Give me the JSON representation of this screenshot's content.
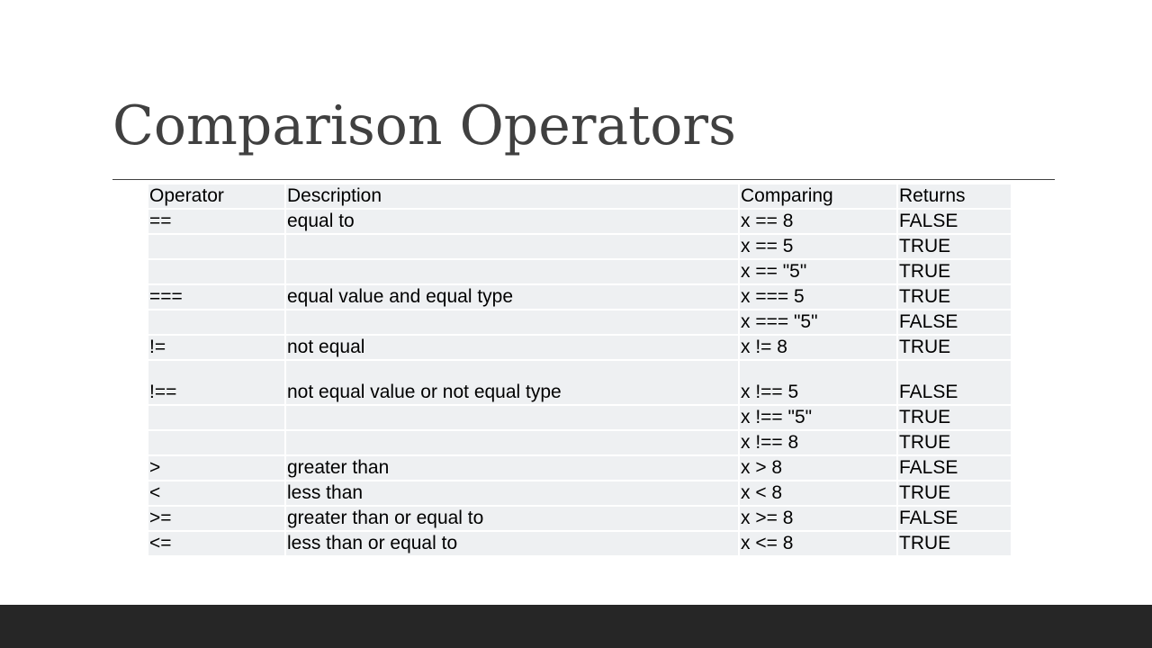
{
  "slide": {
    "title": "Comparison Operators"
  },
  "table": {
    "headers": [
      "Operator",
      "Description",
      "Comparing",
      "Returns"
    ],
    "rows": [
      [
        "==",
        "equal to",
        "x == 8",
        "FALSE"
      ],
      [
        "",
        "",
        "x == 5",
        "TRUE"
      ],
      [
        "",
        "",
        "x == \"5\"",
        "TRUE"
      ],
      [
        "===",
        "equal value and equal type",
        "x === 5",
        "TRUE"
      ],
      [
        "",
        "",
        "x === \"5\"",
        "FALSE"
      ],
      [
        "!=",
        "not equal",
        "x != 8",
        "TRUE"
      ],
      [
        "!==",
        "not equal value or not equal type",
        "x !== 5",
        "FALSE"
      ],
      [
        "",
        "",
        "x !== \"5\"",
        "TRUE"
      ],
      [
        "",
        "",
        "x !== 8",
        "TRUE"
      ],
      [
        ">",
        "greater than",
        "x > 8",
        "FALSE"
      ],
      [
        "<",
        "less than",
        "x < 8",
        "TRUE"
      ],
      [
        ">=",
        "greater than or equal to",
        "x >= 8",
        "FALSE"
      ],
      [
        "<=",
        "less than or equal to",
        "x <= 8",
        "TRUE"
      ]
    ]
  },
  "colors": {
    "title_text": "#404040",
    "cell_background": "#eef0f2",
    "bottom_bar": "#262626"
  }
}
